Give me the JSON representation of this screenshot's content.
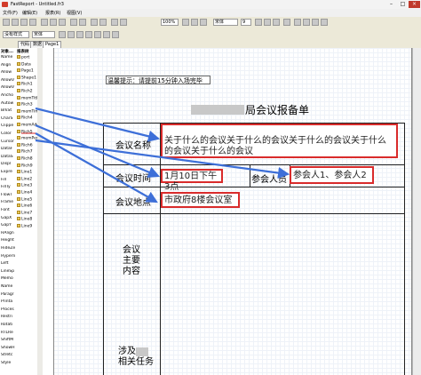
{
  "window": {
    "title": "FastReport - Untitled.fr3"
  },
  "menu": [
    "文件(F)",
    "编辑(E)",
    "报表(R)",
    "视图(V)"
  ],
  "toolbar": {
    "font_name": "宋体",
    "font_size": "9",
    "zoom": "100%"
  },
  "style_toolbar": {
    "style_label": "没有样式",
    "font_name": "宋体"
  },
  "tabs": {
    "code": "代码",
    "data": "数据",
    "page": "Page1"
  },
  "object_panel_title": "对象...",
  "report_tree_title": "报表树",
  "tree_items_left": [
    "Name",
    "Align",
    "Allow",
    "AllowV",
    "AllowV",
    "Ancho",
    "Autow",
    "BrkSt",
    "CharS",
    "Clippe",
    "Color",
    "Cursor",
    "DataF",
    "DataS",
    "Displ",
    "Expre",
    "Fill",
    "FillTy",
    "FlowT",
    "Frame",
    "Font",
    "GapX",
    "GapY",
    "HAlign",
    "Height",
    "HideZe",
    "Hyperli",
    "Left",
    "LineSp",
    "Memo",
    "Name",
    "Paragr",
    "Printa",
    "Proces",
    "Restri",
    "Rotati",
    "RTLRe",
    "ShiftM",
    "ShowH",
    "Stretc",
    "Style"
  ],
  "tree_items_right": [
    "port",
    "Data",
    "Page1",
    "Shape1",
    "Rich1",
    "Rich2",
    "memTitle",
    "Rich3",
    "memTime",
    "Rich4",
    "memAddress",
    "Rich5",
    "memPer",
    "Rich6",
    "Rich7",
    "Rich8",
    "Rich9",
    "Line1",
    "Line2",
    "Line3",
    "Line4",
    "Line5",
    "Line6",
    "Line7",
    "Line8",
    "Line9"
  ],
  "report": {
    "tip": "温馨提示：请提前15分钟入场完毕",
    "title": "局会议报备单",
    "rows": {
      "name_label": "会议名称",
      "name_value": "关于什么的会议关于什么的会议关于什么的会议关于什么的会议关于什么的会议",
      "time_label": "会议时间",
      "time_value": "1月10日下午3点",
      "person_label": "参会人员",
      "person_value": "参会人1、参会人2",
      "place_label": "会议地点",
      "place_value": "市政府8楼会议室",
      "content_label": "会议\n主要\n内容",
      "task_label": "涉及\n相关任务"
    }
  },
  "colors": {
    "arrow": "#3d6fd8",
    "highlight_box": "#d92b2b",
    "accent_red": "#d23b2a"
  }
}
